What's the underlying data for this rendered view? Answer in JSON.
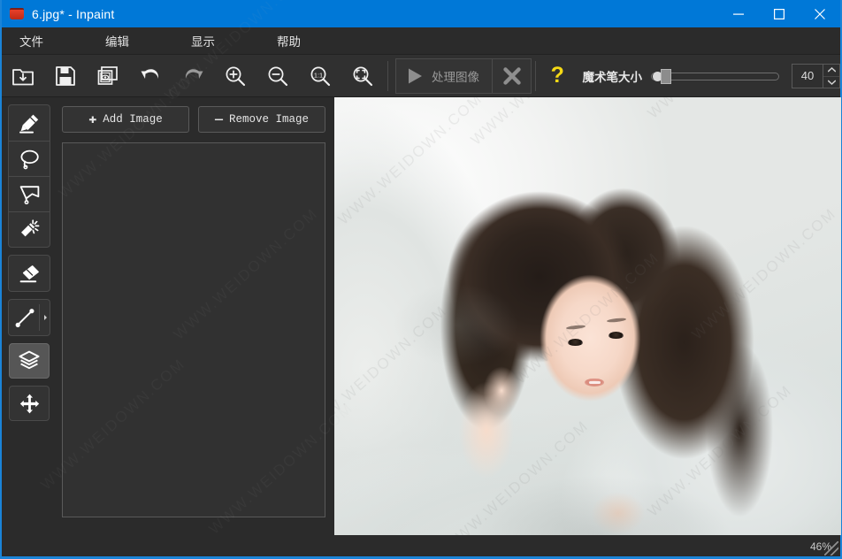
{
  "window": {
    "title": "6.jpg* - Inpaint",
    "app_icon": "paint-bucket-icon",
    "accent_color": "#0078d7",
    "controls": {
      "minimize": "—",
      "maximize": "☐",
      "close": "✕",
      "minimize_name": "minimize-button",
      "maximize_name": "maximize-button",
      "close_name": "close-button"
    }
  },
  "menubar": {
    "items": [
      {
        "label": "文件",
        "name": "menu-file"
      },
      {
        "label": "编辑",
        "name": "menu-edit"
      },
      {
        "label": "显示",
        "name": "menu-view"
      },
      {
        "label": "帮助",
        "name": "menu-help"
      }
    ]
  },
  "toolbar": {
    "buttons": [
      {
        "name": "open-image-icon",
        "tip": "Open"
      },
      {
        "name": "save-image-icon",
        "tip": "Save"
      },
      {
        "name": "compare-preview-icon",
        "tip": "Compare"
      },
      {
        "name": "undo-icon",
        "tip": "Undo"
      },
      {
        "name": "redo-icon",
        "tip": "Redo"
      },
      {
        "name": "zoom-in-icon",
        "tip": "Zoom In"
      },
      {
        "name": "zoom-out-icon",
        "tip": "Zoom 100%"
      },
      {
        "name": "zoom-actual-icon",
        "tip": "Actual Size"
      },
      {
        "name": "zoom-fit-icon",
        "tip": "Fit to Window"
      }
    ],
    "process_label": "处理图像",
    "cancel_glyph": "✕",
    "help_glyph": "?",
    "brush_label": "魔术笔大小",
    "brush_value": "40",
    "brush_min": "1",
    "brush_max": "100",
    "spin_up": "▲",
    "spin_down": "▼"
  },
  "tools": [
    {
      "name": "tool-marker",
      "label": "Marker",
      "selected": false
    },
    {
      "name": "tool-lasso",
      "label": "Lasso",
      "selected": false
    },
    {
      "name": "tool-polygon-lasso",
      "label": "Polygonal Lasso",
      "selected": false
    },
    {
      "name": "tool-magic-wand",
      "label": "Magic Wand",
      "selected": false
    },
    {
      "name": "tool-eraser",
      "label": "Eraser",
      "selected": false
    },
    {
      "name": "tool-guide-line",
      "label": "Guide Line",
      "selected": false
    },
    {
      "name": "tool-multi-view",
      "label": "Multi-View Stamp",
      "selected": true
    },
    {
      "name": "tool-move",
      "label": "Move",
      "selected": false
    }
  ],
  "layers_panel": {
    "add_button": {
      "sign": "✚",
      "label": "Add Image"
    },
    "remove_button": {
      "sign": "—",
      "label": "Remove Image"
    },
    "list_items": []
  },
  "canvas": {
    "image_name": "6.jpg",
    "watermark_text": "WWW.WEIDOWN.COM"
  },
  "statusbar": {
    "zoom_level": "46%"
  }
}
